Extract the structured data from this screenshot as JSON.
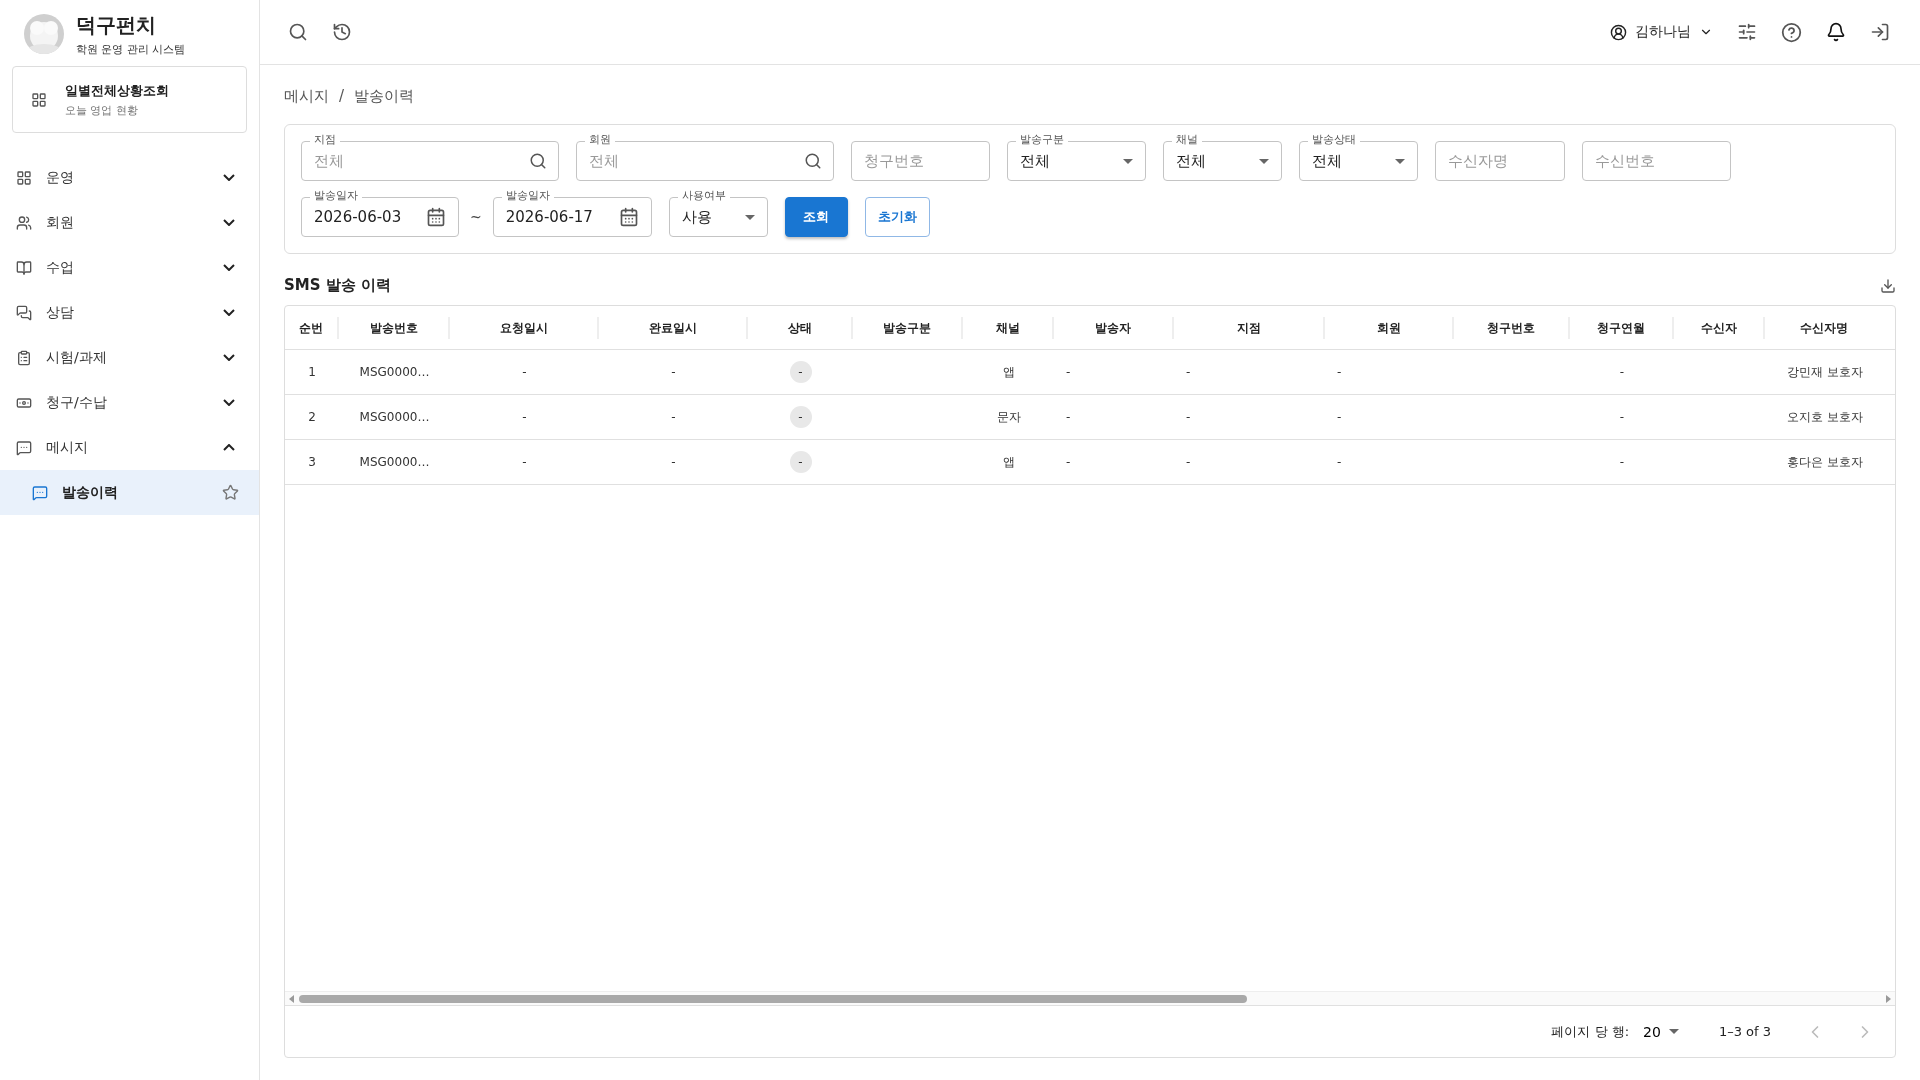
{
  "brand": {
    "title": "덕구펀치",
    "subtitle": "학원 운영 관리 시스템"
  },
  "dashboard_card": {
    "title": "일별전체상황조회",
    "subtitle": "오늘 영업 현황"
  },
  "sidebar": {
    "items": [
      {
        "label": "운영",
        "expanded": false
      },
      {
        "label": "회원",
        "expanded": false
      },
      {
        "label": "수업",
        "expanded": false
      },
      {
        "label": "상담",
        "expanded": false
      },
      {
        "label": "시험/과제",
        "expanded": false
      },
      {
        "label": "청구/수납",
        "expanded": false
      },
      {
        "label": "메시지",
        "expanded": true,
        "children": [
          {
            "label": "발송이력",
            "selected": true,
            "starred": false
          }
        ]
      }
    ]
  },
  "header": {
    "user": "김하나님"
  },
  "breadcrumb": {
    "items": [
      "메시지",
      "발송이력"
    ],
    "separator": "/"
  },
  "filters": [
    {
      "kind": "search",
      "label": "지점",
      "placeholder": "전체"
    },
    {
      "kind": "search",
      "label": "회원",
      "placeholder": "전체"
    },
    {
      "kind": "text",
      "placeholder": "청구번호"
    },
    {
      "kind": "select",
      "label": "발송구분",
      "value": "전체"
    },
    {
      "kind": "select",
      "label": "채널",
      "value": "전체"
    },
    {
      "kind": "select",
      "label": "발송상태",
      "value": "전체"
    },
    {
      "kind": "text",
      "placeholder": "수신자명"
    },
    {
      "kind": "text",
      "placeholder": "수신번호"
    },
    {
      "kind": "date",
      "label": "발송일자",
      "value": "2026-06-03"
    },
    {
      "kind": "separator",
      "text": "~"
    },
    {
      "kind": "date",
      "label": "발송일자",
      "value": "2026-06-17"
    },
    {
      "kind": "select",
      "label": "사용여부",
      "value": "사용"
    },
    {
      "kind": "primary",
      "text": "조회"
    },
    {
      "kind": "outlined",
      "text": "초기화"
    }
  ],
  "table": {
    "title": "SMS 발송 이력",
    "columns": [
      "순번",
      "발송번호",
      "요청일시",
      "완료일시",
      "상태",
      "발송구분",
      "채널",
      "발송자",
      "지점",
      "회원",
      "청구번호",
      "청구연월",
      "수신자",
      "수신자명"
    ],
    "rows": [
      [
        "1",
        "MSG0000…",
        "-",
        "-",
        "-",
        "",
        "앱",
        "-",
        "-",
        "-",
        "",
        "-",
        "",
        "강민재 보호자"
      ],
      [
        "2",
        "MSG0000…",
        "-",
        "-",
        "-",
        "",
        "문자",
        "-",
        "-",
        "-",
        "",
        "-",
        "",
        "오지호 보호자"
      ],
      [
        "3",
        "MSG0000…",
        "-",
        "-",
        "-",
        "",
        "앱",
        "-",
        "-",
        "-",
        "",
        "-",
        "",
        "홍다은 보호자"
      ]
    ]
  },
  "pagination": {
    "rows_per_page_label": "페이지 당 행:",
    "rows_per_page": "20",
    "range": "1–3 of 3"
  }
}
